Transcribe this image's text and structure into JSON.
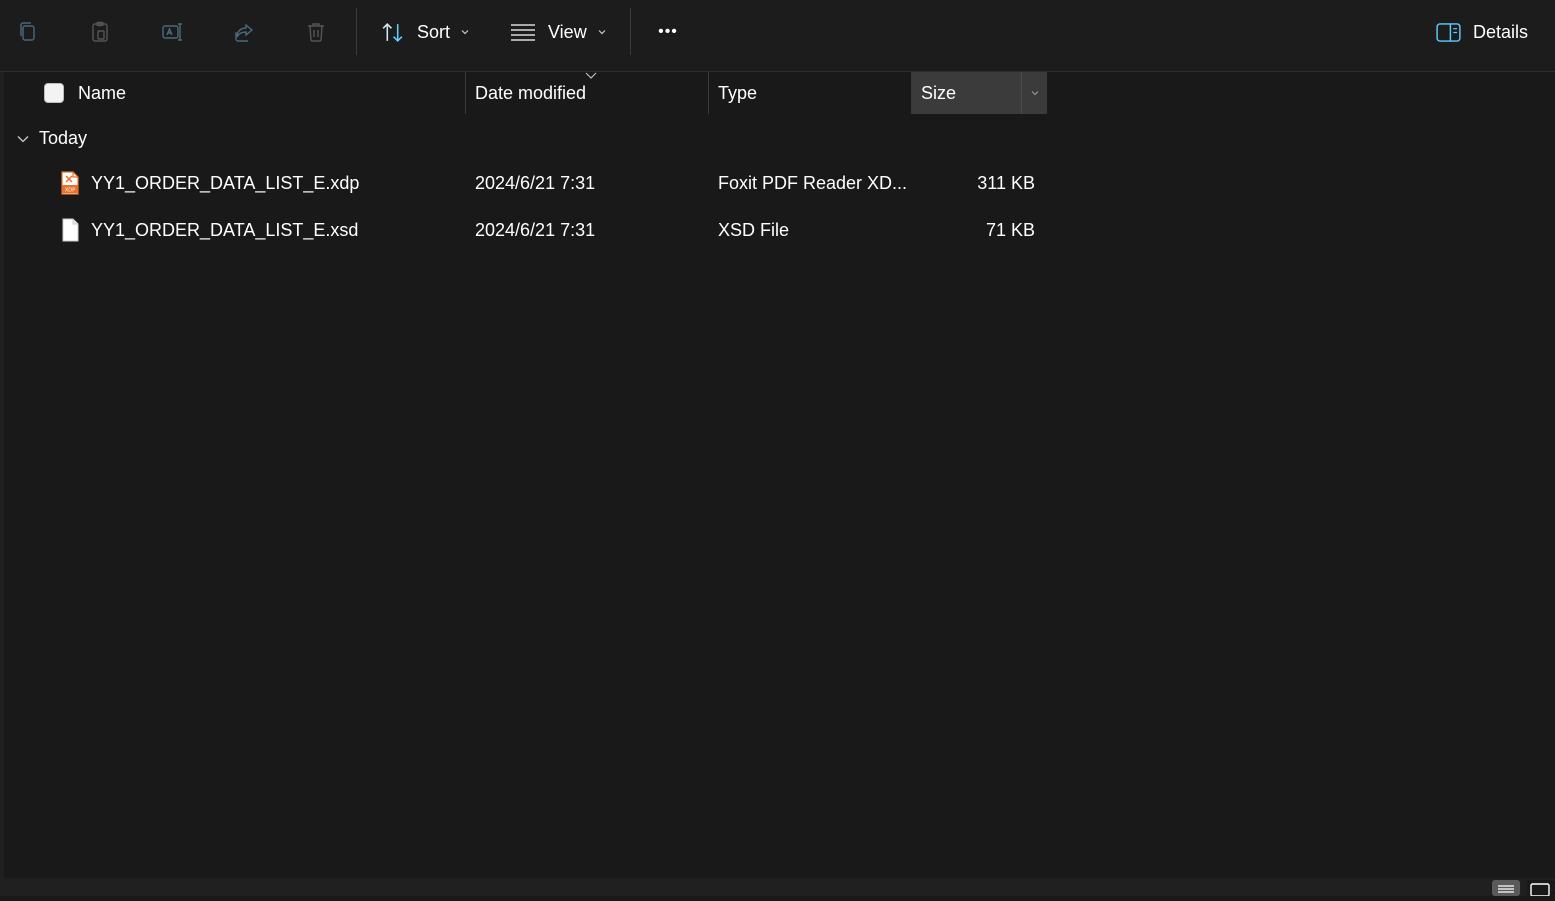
{
  "toolbar": {
    "copy_icon": "copy-icon",
    "paste_icon": "paste-icon",
    "rename_icon": "rename-icon",
    "share_icon": "share-icon",
    "delete_icon": "delete-icon",
    "sort_label": "Sort",
    "view_label": "View",
    "more_label": "•••",
    "details_label": "Details"
  },
  "columns": {
    "name": "Name",
    "date_modified": "Date modified",
    "type": "Type",
    "size": "Size"
  },
  "group": {
    "label": "Today"
  },
  "files": [
    {
      "name": "YY1_ORDER_DATA_LIST_E.xdp",
      "date": "2024/6/21 7:31",
      "type": "Foxit PDF Reader XD...",
      "size": "311 KB",
      "icon": "xdp-file-icon"
    },
    {
      "name": "YY1_ORDER_DATA_LIST_E.xsd",
      "date": "2024/6/21 7:31",
      "type": "XSD File",
      "size": "71 KB",
      "icon": "blank-file-icon"
    }
  ],
  "colors": {
    "background": "#191919",
    "accent": "#60cdff",
    "xdp_icon": "#e8722a"
  }
}
